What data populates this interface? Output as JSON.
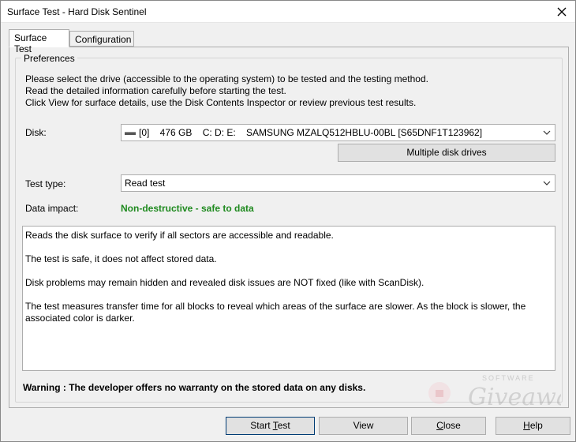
{
  "window": {
    "title": "Surface Test - Hard Disk Sentinel"
  },
  "tabs": [
    {
      "label": "Surface Test",
      "active": true
    },
    {
      "label": "Configuration",
      "active": false
    }
  ],
  "preferences": {
    "legend": "Preferences",
    "intro": [
      "Please select the drive (accessible to the operating system) to be tested and the testing method.",
      "Read the detailed information carefully before starting the test.",
      "Click View for surface details, use the Disk Contents Inspector or review previous test results."
    ],
    "disk_label": "Disk:",
    "disk_value": "[0]    476 GB    C: D: E:    SAMSUNG MZALQ512HBLU-00BL [S65DNF1T123962]",
    "multiple_disks_button": "Multiple disk drives",
    "test_type_label": "Test type:",
    "test_type_value": "Read test",
    "data_impact_label": "Data impact:",
    "data_impact_value": "Non-destructive - safe to data",
    "description": [
      "Reads the disk surface to verify if all sectors are accessible and readable.",
      "The test is safe, it does not affect stored data.",
      "Disk problems may remain hidden and revealed disk issues are NOT fixed (like with ScanDisk).",
      "The test measures transfer time for all blocks to reveal which areas of the surface are slower. As the block is slower, the associated color is darker."
    ],
    "warning": "Warning : The developer offers no warranty on the stored data on any disks."
  },
  "buttons": {
    "start_test": {
      "pre": "Start ",
      "underlined": "T",
      "post": "est"
    },
    "view": "View",
    "close": {
      "pre": "",
      "underlined": "C",
      "post": "lose"
    },
    "help": {
      "pre": "",
      "underlined": "H",
      "post": "elp"
    }
  },
  "watermark": {
    "top": "SOFTWARE",
    "main": "Giveaway"
  },
  "colors": {
    "impact_green": "#1f8a1f",
    "default_button_border": "#003c74"
  }
}
